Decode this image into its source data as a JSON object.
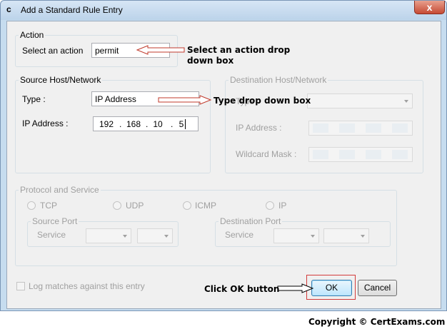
{
  "window": {
    "title": "Add a Standard Rule Entry",
    "app_icon": "c",
    "close_glyph": "x"
  },
  "action_group": {
    "label": "Action",
    "select_label": "Select an action",
    "select_value": "permit"
  },
  "source": {
    "label": "Source Host/Network",
    "type_label": "Type :",
    "type_value": "IP Address",
    "ip_label": "IP Address :",
    "ip_octets": [
      "192",
      "168",
      "10",
      "5"
    ]
  },
  "destination": {
    "label": "Destination Host/Network",
    "type_label": "Type :",
    "ip_label": "IP Address :",
    "mask_label": "Wildcard Mask :"
  },
  "protocol": {
    "label": "Protocol and Service",
    "options": [
      "TCP",
      "UDP",
      "ICMP",
      "IP"
    ],
    "source_port_label": "Source Port",
    "dest_port_label": "Destination Port",
    "service_label": "Service"
  },
  "log_label": "Log matches against this entry",
  "buttons": {
    "ok": "OK",
    "cancel": "Cancel"
  },
  "annotations": {
    "action_note_line1": "Select an action drop",
    "action_note_line2": "down box",
    "type_note": "Type drop down box",
    "ok_note": "Click OK button"
  },
  "copyright": "Copyright © CertExams.com",
  "colors": {
    "arrow_red": "#c0392b",
    "highlight_red": "#d23b3b",
    "disabled_text": "#a0a0a0"
  }
}
